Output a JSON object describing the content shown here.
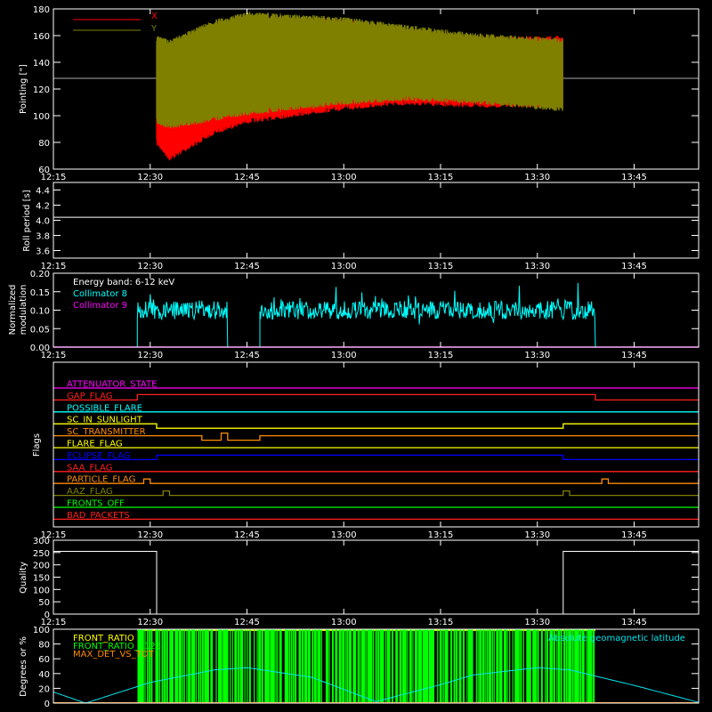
{
  "colors": {
    "background": "#000000",
    "axes": "#ffffff",
    "x_series": "#ff0000",
    "y_series": "#808000",
    "collimator_8": "#00ffff",
    "collimator_9": "#ff00ff",
    "front_ratio": "#ffff00",
    "front_ratio_1125": "#00ff00",
    "max_det_vs_tot": "#ff8c00",
    "geomag": "#00e5ee"
  },
  "chart_data": [
    {
      "type": "line",
      "ylabel": "Pointing [\"]",
      "xlim": [
        "12:15",
        "13:55"
      ],
      "ylim": [
        60,
        180
      ],
      "x_ticks": [
        "12:15",
        "12:30",
        "12:45",
        "13:00",
        "13:15",
        "13:30",
        "13:45"
      ],
      "y_ticks": [
        "60",
        "80",
        "100",
        "120",
        "140",
        "160",
        "180"
      ],
      "legend": [
        "X",
        "Y"
      ],
      "legend_placement": "top-left",
      "reference_line": 128,
      "active_range": [
        "12:31",
        "13:34"
      ],
      "envelope": {
        "x": [
          "12:31",
          "12:33",
          "12:40",
          "12:45",
          "13:00",
          "13:10",
          "13:20",
          "13:34"
        ],
        "X_upper": [
          155,
          148,
          165,
          172,
          170,
          162,
          157,
          158
        ],
        "X_lower": [
          80,
          68,
          88,
          96,
          106,
          110,
          108,
          108
        ],
        "Y_upper": [
          158,
          155,
          170,
          176,
          172,
          166,
          160,
          156
        ],
        "Y_lower": [
          96,
          92,
          98,
          102,
          110,
          113,
          111,
          105
        ]
      }
    },
    {
      "type": "line",
      "ylabel": "Roll period [s]",
      "ylim": [
        3.5,
        4.5
      ],
      "x_ticks": [
        "12:15",
        "12:30",
        "12:45",
        "13:00",
        "13:15",
        "13:30",
        "13:45"
      ],
      "y_ticks": [
        "3.6",
        "3.8",
        "4.0",
        "4.2",
        "4.4"
      ],
      "series": [
        {
          "values": [
            4.04
          ]
        }
      ]
    },
    {
      "type": "line",
      "ylabel": "Normalized modulation",
      "ylim": [
        0,
        0.2
      ],
      "x_ticks": [
        "12:15",
        "12:30",
        "12:45",
        "13:00",
        "13:15",
        "13:30",
        "13:45"
      ],
      "y_ticks": [
        "0.00",
        "0.05",
        "0.10",
        "0.15",
        "0.20"
      ],
      "annotation": "Energy band: 6-12 keV",
      "legend": [
        "Collimator 8",
        "Collimator 9"
      ],
      "legend_placement": "top-left",
      "collimator_8_segments": [
        [
          "12:28",
          "12:42"
        ],
        [
          "12:47",
          "13:39"
        ]
      ],
      "collimator_8_level": 0.1,
      "collimator_9_level": 0.0
    },
    {
      "type": "line",
      "ylabel": "Flags",
      "x_ticks": [
        "12:15",
        "12:30",
        "12:45",
        "13:00",
        "13:15",
        "13:30",
        "13:45"
      ],
      "flags": [
        {
          "name": "ATTENUATOR_STATE",
          "color": "#ff00ff"
        },
        {
          "name": "GAP_FLAG",
          "color": "#ff2020"
        },
        {
          "name": "POSSIBLE_FLARE",
          "color": "#00ffff"
        },
        {
          "name": "SC_IN_SUNLIGHT",
          "color": "#ffff00"
        },
        {
          "name": "SC_TRANSMITTER",
          "color": "#ff8c00"
        },
        {
          "name": "FLARE_FLAG",
          "color": "#ffff00"
        },
        {
          "name": "ECLIPSE_FLAG",
          "color": "#0000ff"
        },
        {
          "name": "SAA_FLAG",
          "color": "#ff2020"
        },
        {
          "name": "PARTICLE_FLAG",
          "color": "#ff8c00"
        },
        {
          "name": "AAZ_FLAG",
          "color": "#808000"
        },
        {
          "name": "FRONTS_OFF",
          "color": "#00ff00"
        },
        {
          "name": "BAD_PACKETS",
          "color": "#ff2020"
        }
      ]
    },
    {
      "type": "line",
      "ylabel": "Quality",
      "ylim": [
        0,
        300
      ],
      "x_ticks": [
        "12:15",
        "12:30",
        "12:45",
        "13:00",
        "13:15",
        "13:30",
        "13:45"
      ],
      "y_ticks": [
        "0",
        "50",
        "100",
        "150",
        "200",
        "250",
        "300"
      ],
      "x": [
        "12:15",
        "12:31",
        "12:31",
        "13:34",
        "13:34",
        "13:55"
      ],
      "values": [
        255,
        255,
        0,
        0,
        255,
        255
      ]
    },
    {
      "type": "line",
      "ylabel": "Degrees or %",
      "ylim": [
        0,
        100
      ],
      "y_ticks": [
        "0",
        "20",
        "40",
        "60",
        "80",
        "100"
      ],
      "legend": [
        "FRONT_RATIO",
        "FRONT_RATIO_1125",
        "MAX_DET_VS_TOT",
        "Absolute geomagnetic latitude"
      ],
      "legend_placement": "top",
      "front_ratio_range": [
        "12:28",
        "13:39"
      ],
      "geomag": {
        "x": [
          "12:15",
          "12:20",
          "12:30",
          "12:40",
          "12:45",
          "12:55",
          "13:05",
          "13:15",
          "13:20",
          "13:30",
          "13:35",
          "13:45",
          "13:55"
        ],
        "values": [
          15,
          0,
          28,
          45,
          48,
          35,
          2,
          25,
          38,
          48,
          45,
          24,
          1
        ]
      }
    }
  ]
}
